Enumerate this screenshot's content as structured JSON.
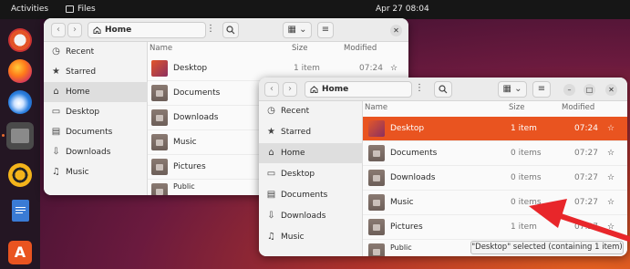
{
  "topbar": {
    "activities": "Activities",
    "app_name": "Files",
    "clock": "Apr 27  08:04"
  },
  "dock": {
    "items": [
      "help-icon",
      "firefox-icon",
      "thunderbird-icon",
      "files-icon",
      "rhythmbox-icon",
      "writer-icon",
      "app-center-icon"
    ]
  },
  "back_window": {
    "path": "Home",
    "columns": {
      "name": "Name",
      "size": "Size",
      "modified": "Modified"
    },
    "sidebar": [
      {
        "label": "Recent",
        "icon": "clock-icon"
      },
      {
        "label": "Starred",
        "icon": "star-icon"
      },
      {
        "label": "Home",
        "icon": "home-icon"
      },
      {
        "label": "Desktop",
        "icon": "desktop-icon"
      },
      {
        "label": "Documents",
        "icon": "document-icon"
      },
      {
        "label": "Downloads",
        "icon": "download-icon"
      },
      {
        "label": "Music",
        "icon": "music-icon"
      }
    ],
    "files": [
      {
        "name": "Desktop",
        "size": "1 item",
        "modified": "07:24"
      },
      {
        "name": "Documents",
        "size": "",
        "modified": ""
      },
      {
        "name": "Downloads",
        "size": "",
        "modified": ""
      },
      {
        "name": "Music",
        "size": "",
        "modified": ""
      },
      {
        "name": "Pictures",
        "size": "",
        "modified": ""
      },
      {
        "name": "Public",
        "size": "",
        "modified": ""
      }
    ]
  },
  "front_window": {
    "path": "Home",
    "columns": {
      "name": "Name",
      "size": "Size",
      "modified": "Modified"
    },
    "sidebar": [
      {
        "label": "Recent",
        "icon": "clock-icon"
      },
      {
        "label": "Starred",
        "icon": "star-icon"
      },
      {
        "label": "Home",
        "icon": "home-icon"
      },
      {
        "label": "Desktop",
        "icon": "desktop-icon"
      },
      {
        "label": "Documents",
        "icon": "document-icon"
      },
      {
        "label": "Downloads",
        "icon": "download-icon"
      },
      {
        "label": "Music",
        "icon": "music-icon"
      }
    ],
    "files": [
      {
        "name": "Desktop",
        "size": "1 item",
        "modified": "07:24"
      },
      {
        "name": "Documents",
        "size": "0 items",
        "modified": "07:27"
      },
      {
        "name": "Downloads",
        "size": "0 items",
        "modified": "07:27"
      },
      {
        "name": "Music",
        "size": "0 items",
        "modified": "07:27"
      },
      {
        "name": "Pictures",
        "size": "1 item",
        "modified": "07:27"
      },
      {
        "name": "Public",
        "size": "",
        "modified": ""
      }
    ],
    "status": "\"Desktop\" selected  (containing 1 item)"
  },
  "colors": {
    "accent": "#e95420",
    "arrow": "#e8262a"
  }
}
